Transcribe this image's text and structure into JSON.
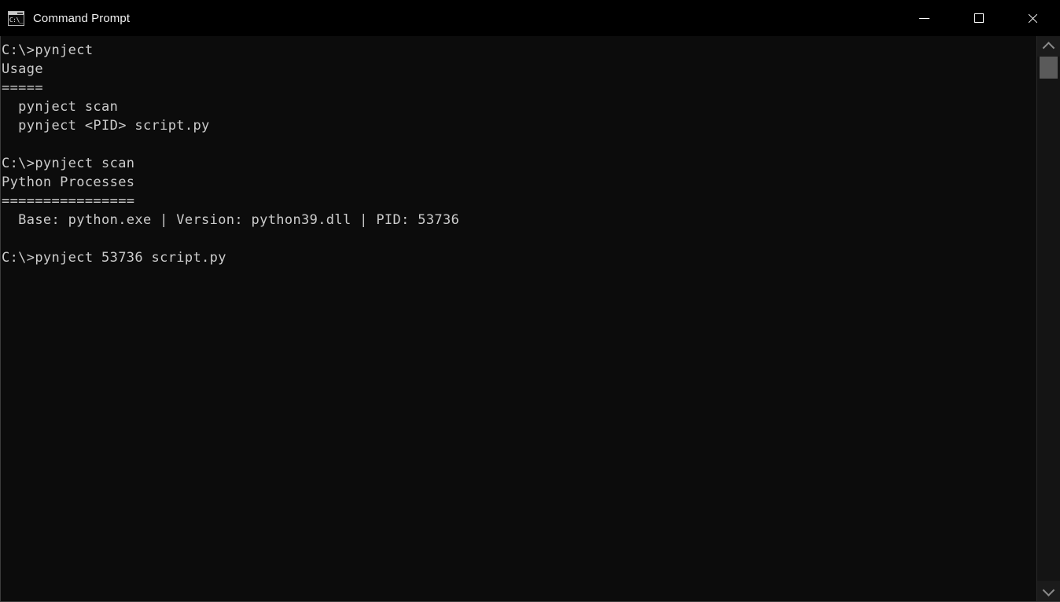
{
  "window": {
    "title": "Command Prompt",
    "icon": "cmd-console-icon",
    "icon_text": "C:\\_",
    "background_color": "#0c0c0c",
    "titlebar_color": "#000000",
    "text_color": "#cccccc",
    "controls": {
      "minimize_label": "Minimize",
      "maximize_label": "Maximize",
      "close_label": "Close"
    }
  },
  "console": {
    "prompt": "C:\\>",
    "blocks": [
      {
        "command": "C:\\>pynject",
        "output": [
          "Usage",
          "=====",
          "  pynject scan",
          "  pynject <PID> script.py"
        ]
      },
      {
        "command": "C:\\>pynject scan",
        "output": [
          "Python Processes",
          "================",
          "  Base: python.exe | Version: python39.dll | PID: 53736"
        ]
      },
      {
        "command": "C:\\>pynject 53736 script.py",
        "output": []
      }
    ],
    "full_text": "C:\\>pynject\nUsage\n=====\n  pynject scan\n  pynject <PID> script.py\n\nC:\\>pynject scan\nPython Processes\n================\n  Base: python.exe | Version: python39.dll | PID: 53736\n\nC:\\>pynject 53736 script.py\n"
  },
  "scrollbar": {
    "up_arrow": "scroll-up-arrow",
    "down_arrow": "scroll-down-arrow",
    "thumb": "scroll-thumb"
  }
}
